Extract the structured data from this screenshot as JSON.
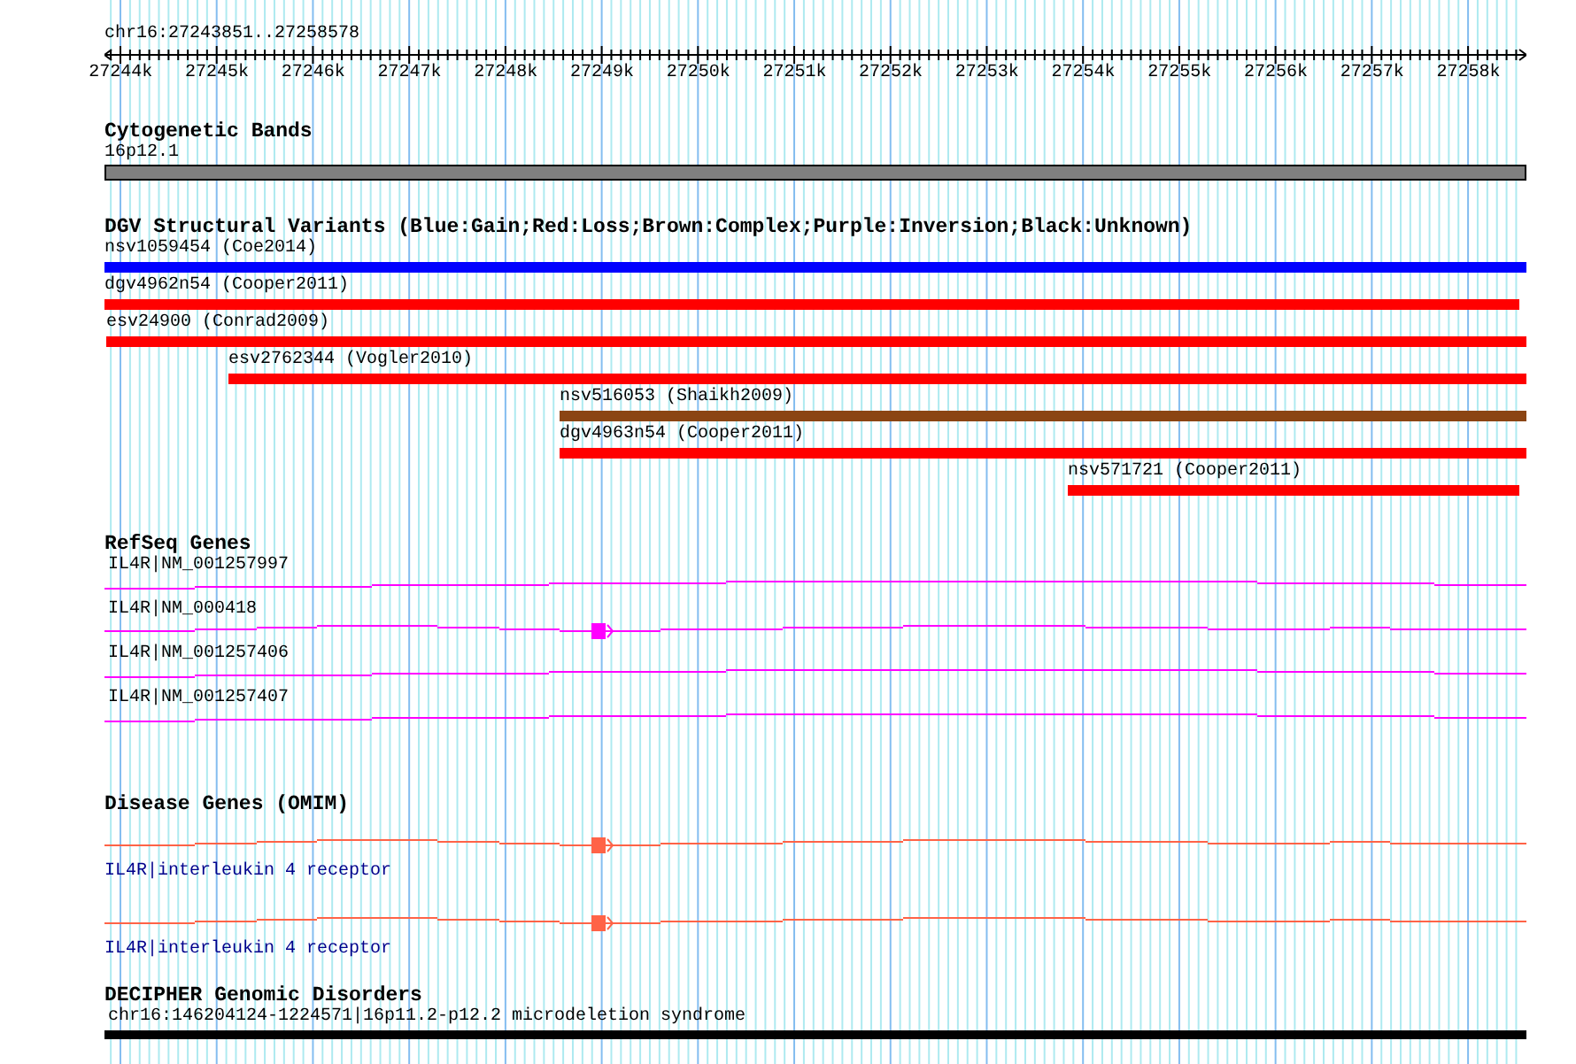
{
  "ruler": {
    "location": "chr16:27243851..27258578",
    "ticks": [
      "27244k",
      "27245k",
      "27246k",
      "27247k",
      "27248k",
      "27249k",
      "27250k",
      "27251k",
      "27252k",
      "27253k",
      "27254k",
      "27255k",
      "27256k",
      "27257k",
      "27258k"
    ]
  },
  "tracks": [
    {
      "kind": "bands",
      "title": "Cytogenetic Bands",
      "features": [
        {
          "label": "16p12.1"
        }
      ]
    },
    {
      "kind": "variants",
      "title": "DGV Structural Variants (Blue:Gain;Red:Loss;Brown:Complex;Purple:Inversion;Black:Unknown)",
      "features": [
        {
          "label": "nsv1059454 (Coe2014)",
          "color": "#0000ff"
        },
        {
          "label": "dgv4962n54 (Cooper2011)",
          "color": "#ff0000"
        },
        {
          "label": "esv24900 (Conrad2009)",
          "color": "#ff0000"
        },
        {
          "label": "esv2762344 (Vogler2010)",
          "color": "#ff0000"
        },
        {
          "label": "nsv516053 (Shaikh2009)",
          "color": "#8b4513"
        },
        {
          "label": "dgv4963n54 (Cooper2011)",
          "color": "#ff0000"
        },
        {
          "label": "nsv571721 (Cooper2011)",
          "color": "#ff0000"
        }
      ]
    },
    {
      "kind": "genes",
      "title": "RefSeq Genes",
      "features": [
        {
          "label": "IL4R|NM_001257997"
        },
        {
          "label": "IL4R|NM_000418"
        },
        {
          "label": "IL4R|NM_001257406"
        },
        {
          "label": "IL4R|NM_001257407"
        }
      ]
    },
    {
      "kind": "disease",
      "title": "Disease Genes (OMIM)",
      "features": [
        {
          "label": "IL4R|interleukin 4 receptor"
        },
        {
          "label": "IL4R|interleukin 4 receptor"
        }
      ]
    },
    {
      "kind": "disorders",
      "title": "DECIPHER Genomic Disorders",
      "features": [
        {
          "label": "chr16:146204124-1224571|16p11.2-p12.2 microdeletion syndrome"
        }
      ]
    }
  ]
}
